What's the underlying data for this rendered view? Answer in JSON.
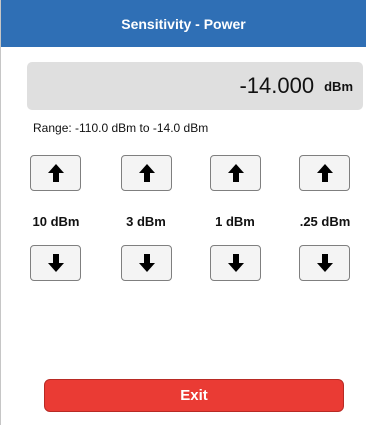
{
  "header": {
    "title": "Sensitivity - Power"
  },
  "readout": {
    "value": "-14.000",
    "unit": "dBm"
  },
  "range_text": "Range: -110.0 dBm to -14.0 dBm",
  "steps": [
    {
      "label": "10 dBm",
      "up_icon": "arrow-up-icon",
      "down_icon": "arrow-down-icon"
    },
    {
      "label": "3 dBm",
      "up_icon": "arrow-up-icon",
      "down_icon": "arrow-down-icon"
    },
    {
      "label": "1 dBm",
      "up_icon": "arrow-up-icon",
      "down_icon": "arrow-down-icon"
    },
    {
      "label": ".25 dBm",
      "up_icon": "arrow-up-icon",
      "down_icon": "arrow-down-icon"
    }
  ],
  "exit_label": "Exit",
  "colors": {
    "header_bg": "#2f6fb5",
    "exit_bg": "#ea3b34",
    "readout_bg": "#dfdfdf"
  }
}
